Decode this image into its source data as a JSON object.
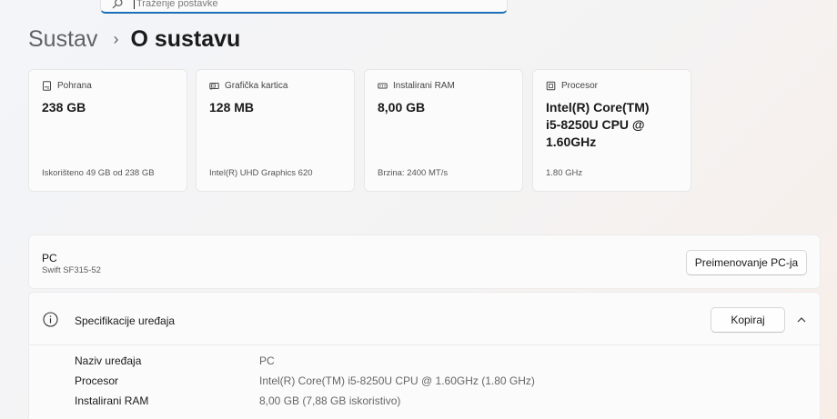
{
  "search": {
    "placeholder": "Traženje postavke",
    "icon": "search-icon"
  },
  "breadcrumb": {
    "parent": "Sustav",
    "separator": "›",
    "current": "O sustavu"
  },
  "cards": [
    {
      "icon": "storage-icon",
      "title": "Pohrana",
      "value": "238 GB",
      "sub": "Iskorišteno 49 GB od 238 GB"
    },
    {
      "icon": "graphics-card-icon",
      "title": "Grafička kartica",
      "value": "128 MB",
      "sub": "Intel(R) UHD Graphics 620"
    },
    {
      "icon": "ram-icon",
      "title": "Instalirani RAM",
      "value": "8,00 GB",
      "sub": "Brzina: 2400 MT/s"
    },
    {
      "icon": "processor-icon",
      "title": "Procesor",
      "value": "Intel(R) Core(TM) i5-8250U CPU @ 1.60GHz",
      "sub": "1.80 GHz"
    }
  ],
  "pc": {
    "name": "PC",
    "model": "Swift SF315-52",
    "rename_label": "Preimenovanje PC-ja"
  },
  "specs": {
    "title": "Specifikacije uređaja",
    "copy_label": "Kopiraj",
    "rows": [
      {
        "label": "Naziv uređaja",
        "value": "PC"
      },
      {
        "label": "Procesor",
        "value": "Intel(R) Core(TM) i5-8250U CPU @ 1.60GHz (1.80 GHz)"
      },
      {
        "label": "Instalirani RAM",
        "value": "8,00 GB (7,88 GB iskoristivo)"
      }
    ]
  },
  "colors": {
    "accent": "#1a6fb8",
    "background": "#f3f4f7",
    "card": "#fbfbfb"
  }
}
